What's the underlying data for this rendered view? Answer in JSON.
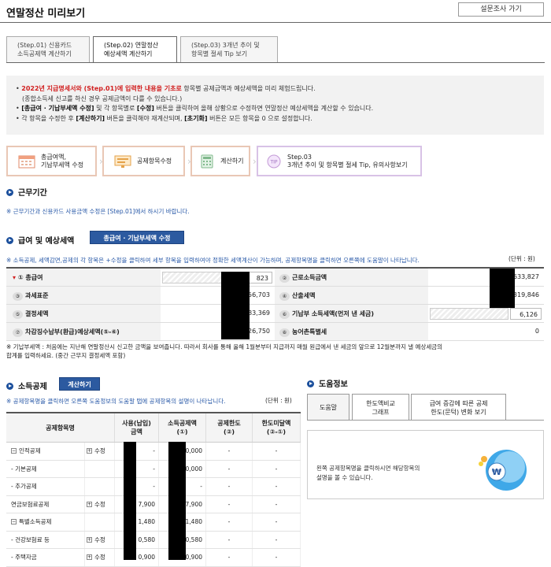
{
  "header": {
    "title": "연말정산 미리보기",
    "survey_button": "설문조사 가기"
  },
  "tabs": [
    {
      "line1": "(Step.01) 신용카드",
      "line2": "소득공제액 계산하기"
    },
    {
      "line1": "(Step.02) 연말정산",
      "line2": "예상세액 계산하기"
    },
    {
      "line1": "(Step.03) 3개년 추이 및",
      "line2": "항목별 절세 Tip 보기"
    }
  ],
  "notice": {
    "line1_red": "2022년 지급명세서와 (Step.01)에 입력한 내용을 기초로",
    "line1_rest": " 항목별 공제금액과 예상세액을 미리 체험드립니다.",
    "line2": "(종합소득세 신고를 하신 경우 공제금액이 다를 수 있습니다.)",
    "line3_bold": "[총급여 · 기납부세액 수정]",
    "line3_mid": " 및 각 항목별로 ",
    "line3_bold2": "[수정]",
    "line3_rest": " 버튼을 클릭하여 올해 상황으로 수정하면 연말정산 예상세액을 계산할 수 있습니다.",
    "line4_a": "각 항목을 수정한 후 ",
    "line4_b": "[계산하기]",
    "line4_c": " 버튼을 클릭해야 재계산되며, ",
    "line4_d": "[초기화]",
    "line4_e": " 버튼은 모든 항목을 0 으로 설정합니다."
  },
  "steps": [
    {
      "line1": "총급여액,",
      "line2": "기납부세액 수정",
      "icon": "calendar-icon"
    },
    {
      "line1": "공제항목수정",
      "line2": "",
      "icon": "monitor-icon"
    },
    {
      "line1": "계산하기",
      "line2": "",
      "icon": "calculator-icon"
    },
    {
      "line1": "Step.03",
      "line2": "3개년 추이 및 항목별 절세 Tip, 유의사항보기",
      "icon": "tip-icon",
      "badge": "TIP"
    }
  ],
  "work_period": {
    "title": "근무기간",
    "note": "※ 근무기간과 신용카드 사용금액 수정은 [Step.01]에서 하시기 바랍니다."
  },
  "salary": {
    "title": "급여 및 예상세액",
    "edit_button": "총급여 · 기납부세액 수정",
    "note": "※ 소득공제, 세액감면,공제의 각 항목은 +수정을 클릭하여 세부 항목을 입력하여야 정확한 세액계산이 가능하며, 공제항목명을 클릭하면 오른쪽에 도움말이 나타납니다.",
    "unit": "(단위 : 원)",
    "rows": [
      {
        "n1": "①",
        "l1": "총급여",
        "v1": "823",
        "n2": "②",
        "l2": "근로소득금액",
        "v2": "633,827"
      },
      {
        "n1": "③",
        "l1": "과세표준",
        "v1": "56,703",
        "n2": "④",
        "l2": "산출세액",
        "v2": "319,846"
      },
      {
        "n1": "⑤",
        "l1": "결정세액",
        "v1": "83,369",
        "n2": "⑥",
        "l2": "기납부 소득세액(먼저 낸 세금)",
        "v2": "6,126"
      },
      {
        "n1": "⑦",
        "l1": "차감징수납부(환급)예상세액(⑤-⑥)",
        "v1": "26,750",
        "n2": "⑧",
        "l2": "농어촌특별세",
        "v2": "0"
      }
    ],
    "footnote1": "※ 기납부세액 : 처음에는 지난해 연말정산시 신고한 금액을 보여줍니다. 따라서 회사를 통해 올해 1월분부터 지급까지 매월 원급에서 낸 세금의 앞으로 12월분까지 낼 예상세금의",
    "footnote2": "합계를 입력하세요. (중간 근무지 결정세액 포함)"
  },
  "deduction": {
    "title": "소득공제",
    "calc_button": "계산하기",
    "note": "※ 공제항목명을 클릭하면 오른쪽 도움정보의 도움말 탭에 공제항목의 설명이 나타납니다.",
    "unit": "(단위 : 원)",
    "headers": [
      "공제항목명",
      "사용(납입)\n금액",
      "소득공제액\n(①)",
      "공제한도\n(②)",
      "한도미달액\n(②-①)"
    ],
    "rows": [
      {
        "name": "인적공제",
        "expand": "⊟",
        "edit": "수정",
        "used": "-",
        "ded": "00,000",
        "limit": "-",
        "diff": "-"
      },
      {
        "name": "- 기본공제",
        "expand": "",
        "edit": "",
        "used": "-",
        "ded": "00,000",
        "limit": "-",
        "diff": "-"
      },
      {
        "name": "- 추가공제",
        "expand": "",
        "edit": "",
        "used": "-",
        "ded": "-",
        "limit": "-",
        "diff": "-"
      },
      {
        "name": "연금보험료공제",
        "expand": "",
        "edit": "수정",
        "used": "7,900",
        "ded": "07,900",
        "limit": "-",
        "diff": "-"
      },
      {
        "name": "특별소득공제",
        "expand": "⊟",
        "edit": "",
        "used": "1,480",
        "ded": "31,480",
        "limit": "-",
        "diff": "-"
      },
      {
        "name": "- 건강보험료 등",
        "expand": "",
        "edit": "수정",
        "used": "0,580",
        "ded": "00,580",
        "limit": "-",
        "diff": "-"
      },
      {
        "name": "- 주택자금",
        "expand": "",
        "edit": "수정",
        "used": "0,900",
        "ded": "0,900",
        "limit": "-",
        "diff": "-"
      }
    ]
  },
  "help": {
    "title": "도움정보",
    "tabs": [
      "도움말",
      "한도액비교\n그래프",
      "급여 증감에 따른 공제\n한도(문턱) 변화 보기"
    ],
    "text1": "왼쪽 공제항목명을 클릭하시면 해당항목의",
    "text2": "설명을 볼 수 있습니다."
  }
}
